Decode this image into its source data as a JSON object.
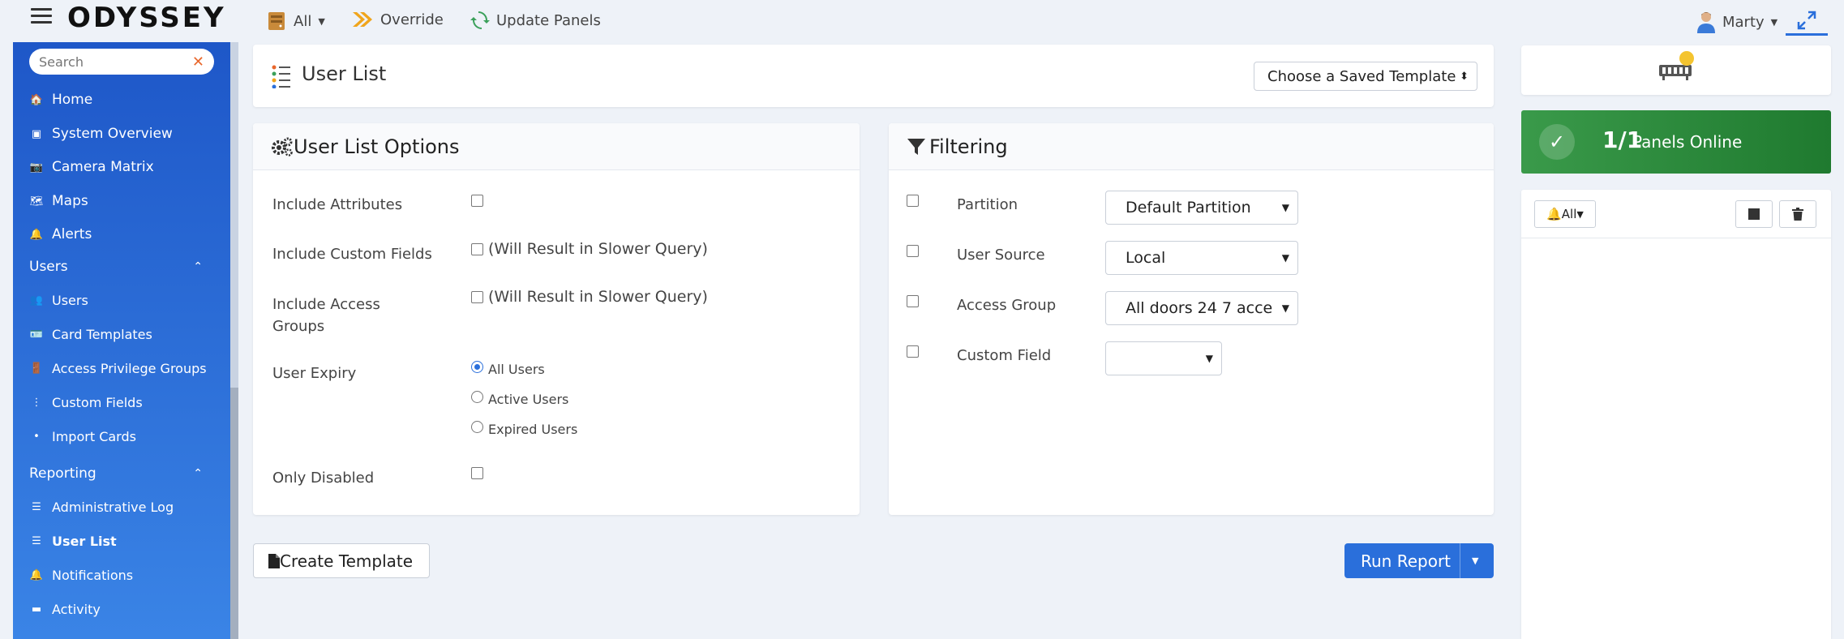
{
  "app": {
    "logo": "ODYSSEY"
  },
  "topbar": {
    "all_label": "All",
    "override_label": "Override",
    "update_label": "Update Panels",
    "user_label": "Marty"
  },
  "sidebar": {
    "search_placeholder": "Search",
    "items": [
      {
        "label": "Home"
      },
      {
        "label": "System Overview"
      },
      {
        "label": "Camera Matrix"
      },
      {
        "label": "Maps"
      },
      {
        "label": "Alerts"
      }
    ],
    "users_section": "Users",
    "users_items": [
      {
        "label": "Users"
      },
      {
        "label": "Card Templates"
      },
      {
        "label": "Access Privilege Groups"
      },
      {
        "label": "Custom Fields"
      },
      {
        "label": "Import Cards"
      }
    ],
    "reporting_section": "Reporting",
    "reporting_items": [
      {
        "label": "Administrative Log"
      },
      {
        "label": "User List"
      },
      {
        "label": "Notifications"
      },
      {
        "label": "Activity"
      }
    ]
  },
  "header": {
    "title": "User List",
    "template_select": "Choose a Saved Template"
  },
  "options": {
    "title": "User List Options",
    "include_attributes": "Include Attributes",
    "include_custom_fields": "Include Custom Fields",
    "slow_hint_1": "(Will Result in Slower Query)",
    "include_access_groups": "Include Access Groups",
    "slow_hint_2": "(Will Result in Slower Query)",
    "user_expiry": "User Expiry",
    "expiry_all": "All Users",
    "expiry_active": "Active Users",
    "expiry_expired": "Expired Users",
    "only_disabled": "Only Disabled"
  },
  "filtering": {
    "title": "Filtering",
    "partition_label": "Partition",
    "partition_value": "Default Partition",
    "user_source_label": "User Source",
    "user_source_value": "Local",
    "access_group_label": "Access Group",
    "access_group_value": "All doors 24 7 acce",
    "custom_field_label": "Custom Field",
    "custom_field_value": ""
  },
  "actions": {
    "create_template": "Create Template",
    "run_report": "Run Report"
  },
  "right_panel": {
    "panels_count": "1/1",
    "panels_label": "Panels Online",
    "bell_filter": "All"
  },
  "colors": {
    "primary": "#2a6fdb",
    "sidebar_top": "#1e57c8",
    "sidebar_bottom": "#3a84e6",
    "online_green": "#2e8b3e",
    "accent_orange": "#e8672c"
  }
}
